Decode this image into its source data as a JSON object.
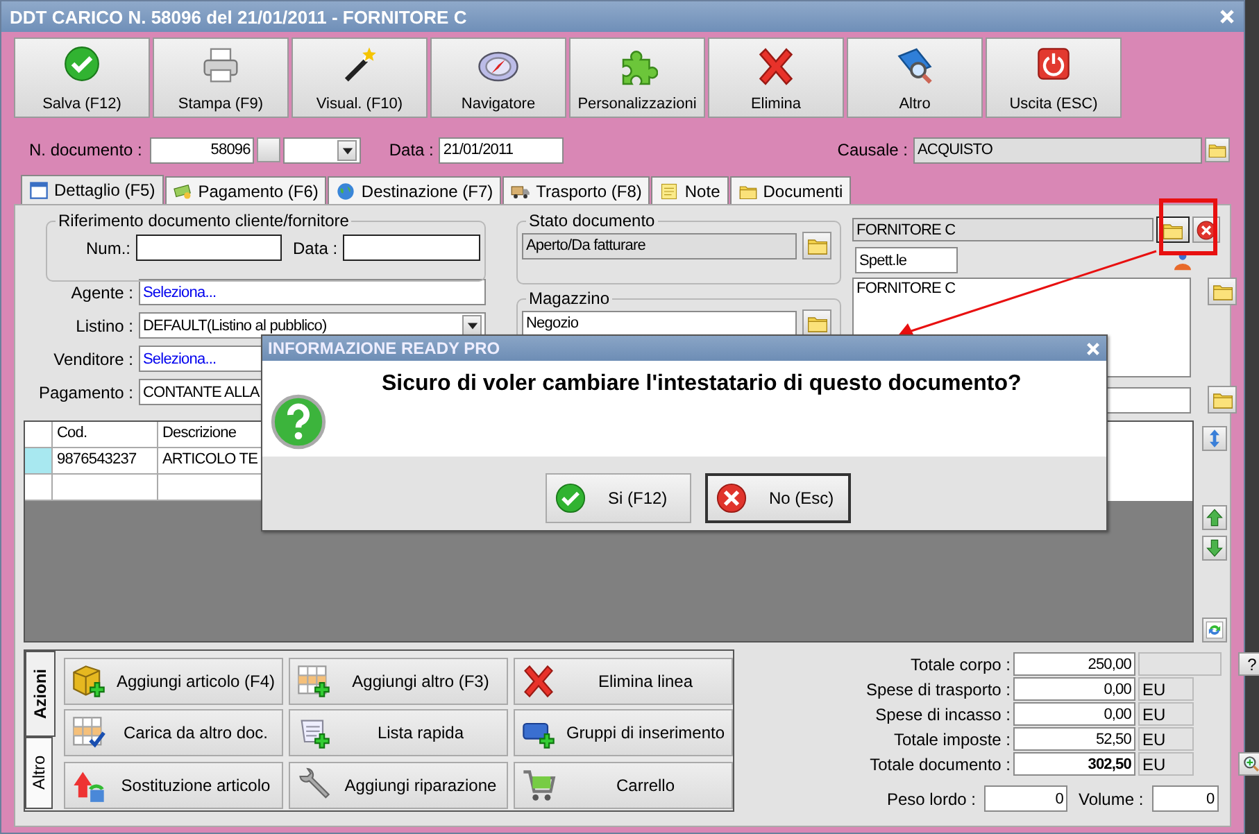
{
  "window": {
    "title": "DDT CARICO N. 58096 del 21/01/2011 - FORNITORE C"
  },
  "toolbar": [
    {
      "label": "Salva (F12)",
      "kind": "save"
    },
    {
      "label": "Stampa (F9)",
      "kind": "print"
    },
    {
      "label": "Visual. (F10)",
      "kind": "preview"
    },
    {
      "label": "Navigatore",
      "kind": "navigator"
    },
    {
      "label": "Personalizzazioni",
      "kind": "customize"
    },
    {
      "label": "Elimina",
      "kind": "delete"
    },
    {
      "label": "Altro",
      "kind": "more"
    },
    {
      "label": "Uscita (ESC)",
      "kind": "exit"
    }
  ],
  "header": {
    "doc_number_label": "N. documento :",
    "doc_number": "58096",
    "date_label": "Data :",
    "date": "21/01/2011",
    "causale_label": "Causale :",
    "causale": "ACQUISTO"
  },
  "tabs": [
    {
      "label": "Dettaglio (F5)",
      "kind": "detail",
      "selected": true
    },
    {
      "label": "Pagamento (F6)",
      "kind": "payment",
      "selected": false
    },
    {
      "label": "Destinazione (F7)",
      "kind": "destination",
      "selected": false
    },
    {
      "label": "Trasporto (F8)",
      "kind": "transport",
      "selected": false
    },
    {
      "label": "Note",
      "kind": "notes",
      "selected": false
    },
    {
      "label": "Documenti",
      "kind": "documents",
      "selected": false
    }
  ],
  "reference": {
    "title": "Riferimento documento cliente/fornitore",
    "num_label": "Num.:",
    "date_label": "Data :"
  },
  "fields": [
    {
      "label": "Agente :",
      "value": "Seleziona...",
      "kind": "link"
    },
    {
      "label": "Listino :",
      "value": "DEFAULT(Listino al pubblico)",
      "kind": "select"
    },
    {
      "label": "Venditore :",
      "value": "Seleziona...",
      "kind": "link"
    },
    {
      "label": "Pagamento :",
      "value": "CONTANTE ALLA",
      "kind": "text"
    }
  ],
  "status": {
    "title": "Stato documento",
    "value": "Aperto/Da fatturare"
  },
  "warehouse": {
    "title": "Magazzino",
    "value": "Negozio"
  },
  "supplier": {
    "name": "FORNITORE C",
    "salutation": "Spett.le",
    "address": "FORNITORE C"
  },
  "grid": {
    "columns": [
      "Cod.",
      "Descrizione"
    ],
    "rows": [
      [
        "9876543237",
        "ARTICOLO TE"
      ]
    ]
  },
  "action_tabs": [
    {
      "label": "Azioni",
      "selected": true
    },
    {
      "label": "Altro",
      "selected": false
    }
  ],
  "actions": [
    {
      "label": "Aggiungi articolo (F4)",
      "kind": "add-item"
    },
    {
      "label": "Aggiungi altro (F3)",
      "kind": "add-other"
    },
    {
      "label": "Elimina linea",
      "kind": "delete-line"
    },
    {
      "label": "Carica da altro doc.",
      "kind": "load"
    },
    {
      "label": "Lista rapida",
      "kind": "quick-list"
    },
    {
      "label": "Gruppi di inserimento",
      "kind": "groups"
    },
    {
      "label": "Sostituzione articolo",
      "kind": "replace"
    },
    {
      "label": "Aggiungi riparazione",
      "kind": "repair"
    },
    {
      "label": "Carrello",
      "kind": "cart"
    }
  ],
  "totals": [
    {
      "label": "Totale corpo :",
      "value": "250,00",
      "bold": false
    },
    {
      "label": "Spese di trasporto :",
      "value": "0,00",
      "unit": "EU",
      "bold": false
    },
    {
      "label": "Spese di incasso :",
      "value": "0,00",
      "unit": "EU",
      "bold": false
    },
    {
      "label": "Totale imposte :",
      "value": "52,50",
      "unit": "EU",
      "bold": false
    },
    {
      "label": "Totale documento :",
      "value": "302,50",
      "unit": "EU",
      "bold": true
    }
  ],
  "help_button": "?",
  "weight": {
    "label": "Peso lordo :",
    "value": "0"
  },
  "volume": {
    "label": "Volume :",
    "value": "0"
  },
  "dialog": {
    "title": "INFORMAZIONE READY PRO",
    "message": "Sicuro di voler cambiare l'intestatario di questo documento?",
    "buttons": [
      {
        "label": "Si (F12)",
        "kind": "yes",
        "selected": false
      },
      {
        "label": "No (Esc)",
        "kind": "no",
        "selected": true
      }
    ]
  }
}
